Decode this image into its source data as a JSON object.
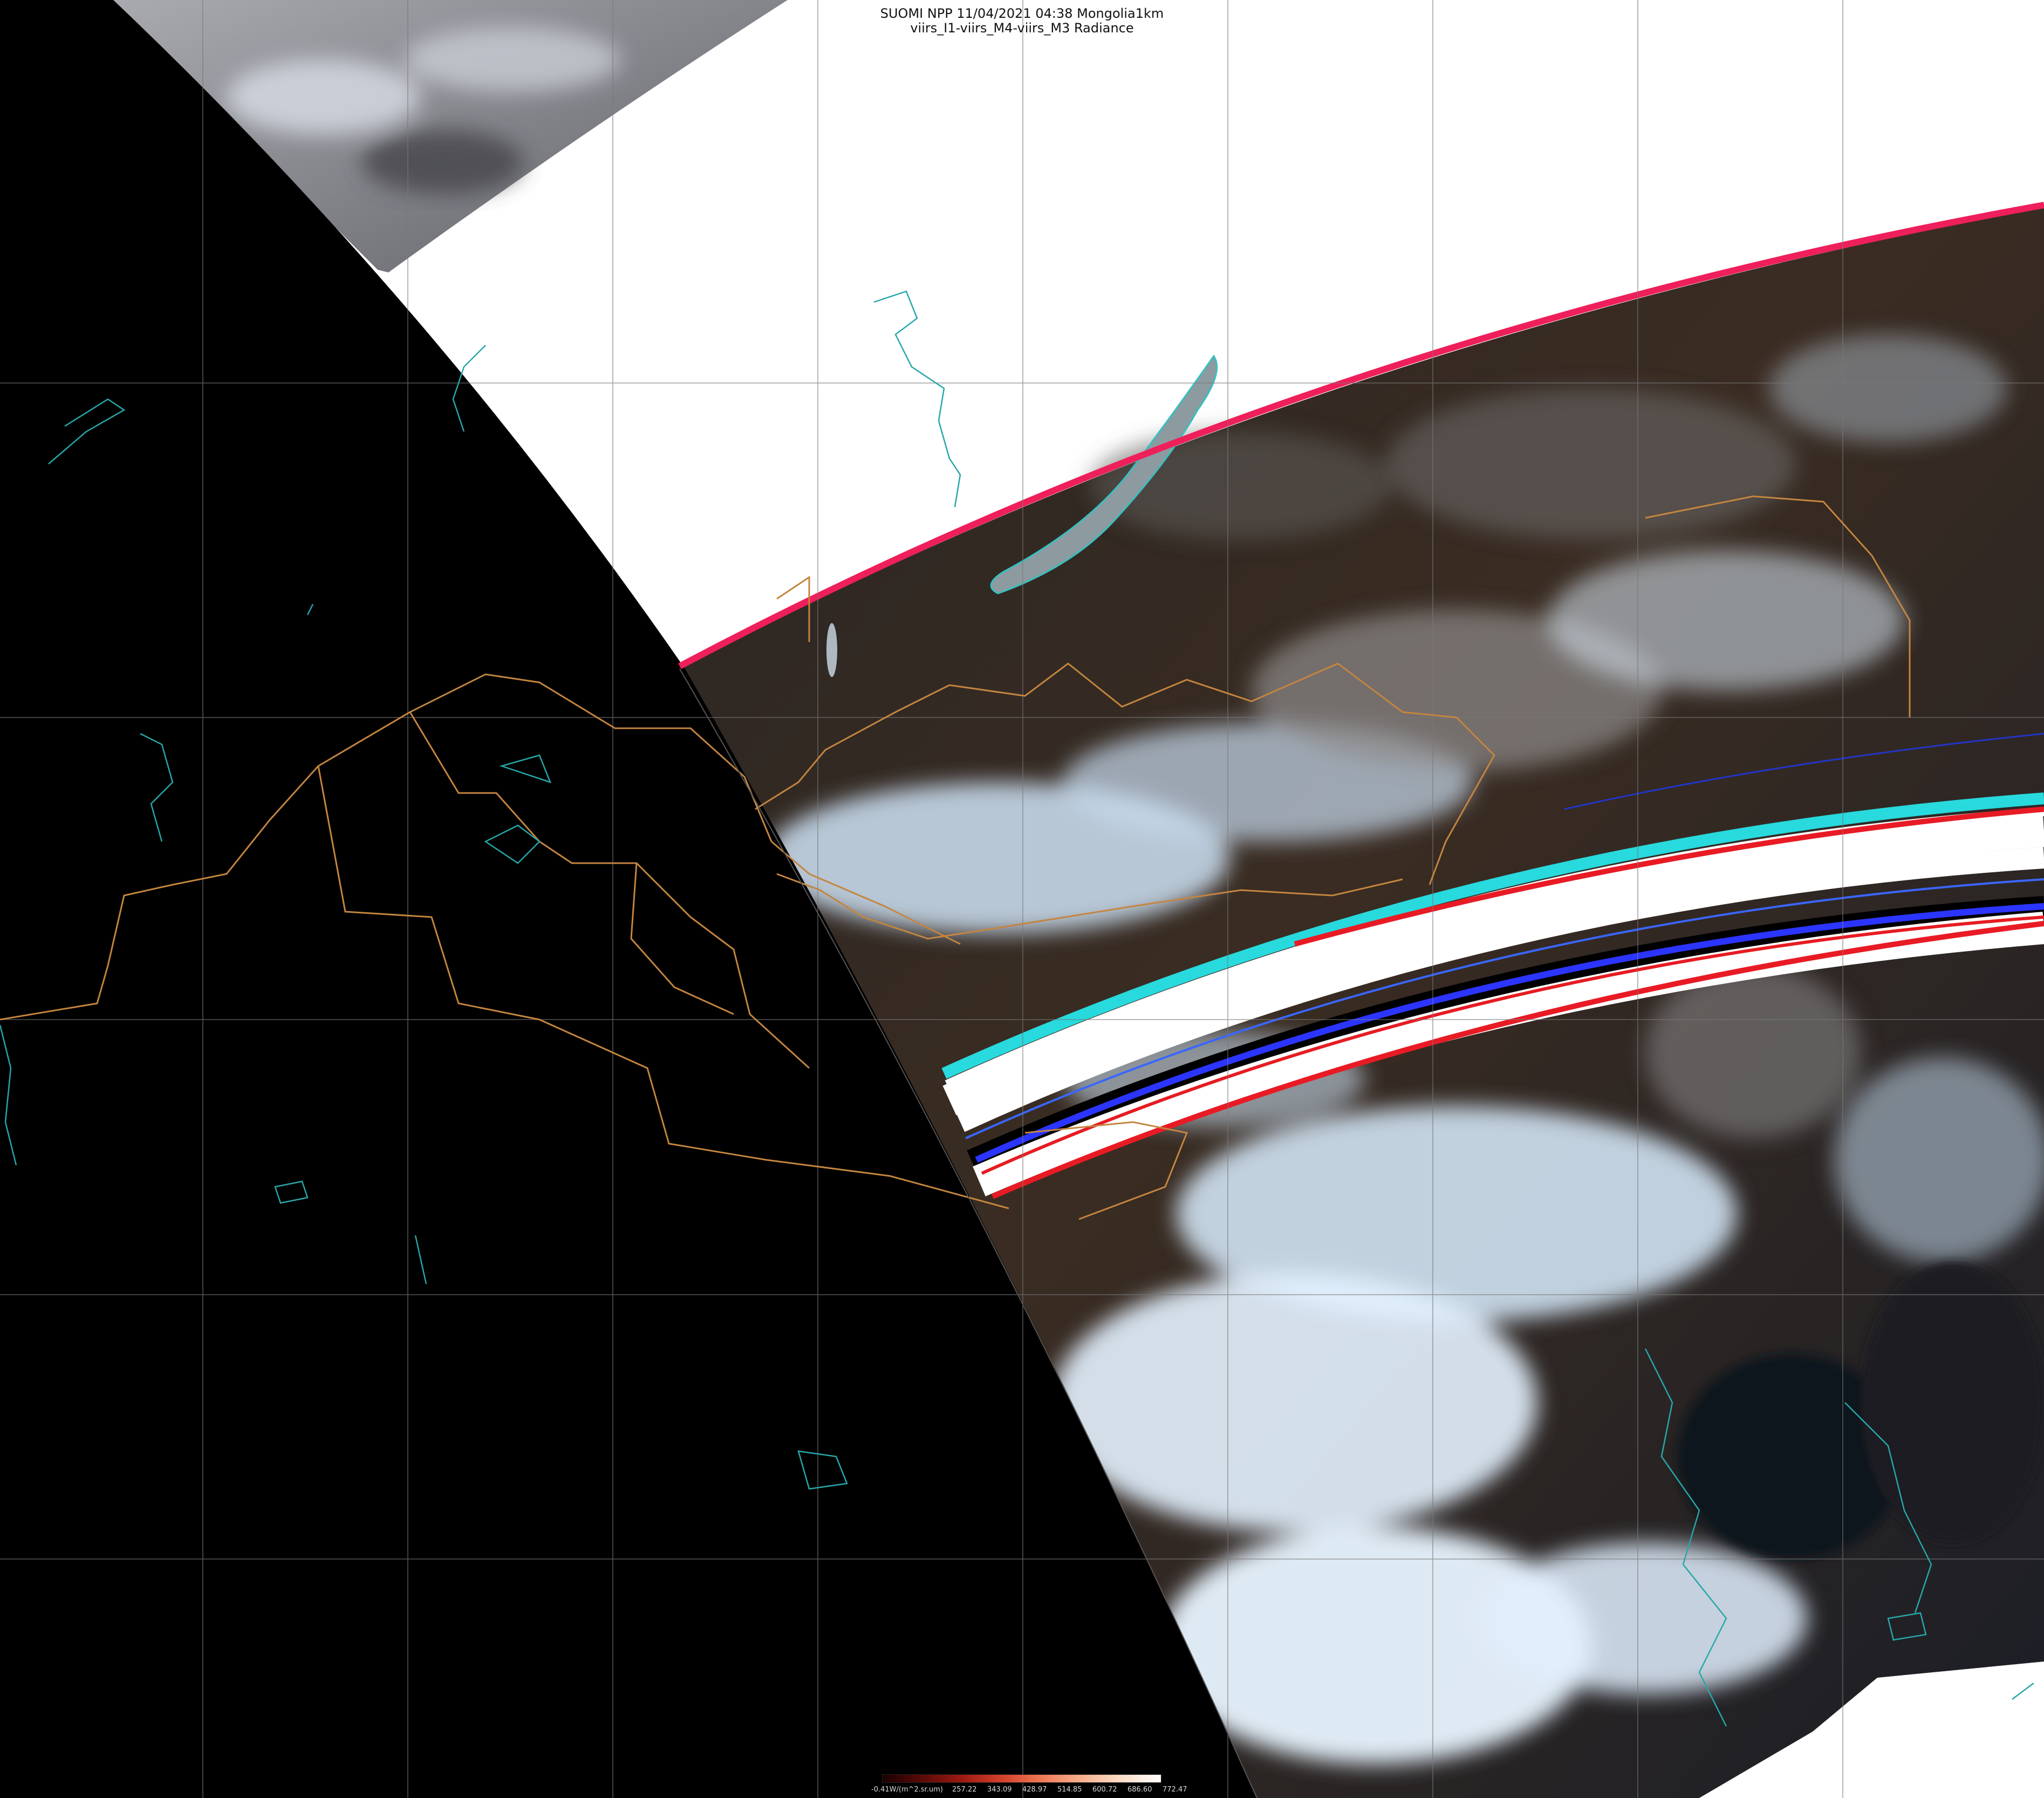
{
  "title": {
    "line1": "SUOMI NPP 11/04/2021 04:38 Mongolia1km",
    "line2": "viirs_I1-viirs_M4-viirs_M3 Radiance"
  },
  "colorbar": {
    "ticks": [
      "-0.41W/(m^2.sr.um)",
      "257.22",
      "343.09",
      "428.97",
      "514.85",
      "600.72",
      "686.60",
      "772.47"
    ],
    "colors": [
      "#1a0000",
      "#5a0a08",
      "#9b1a12",
      "#d2402a",
      "#ee7a55",
      "#f7b08e",
      "#fcdcc8",
      "#ffffff"
    ]
  },
  "map": {
    "projection_grid": "lat-lon graticule",
    "layers": [
      "satellite-swath",
      "country-borders",
      "coastlines-lakes",
      "graticule"
    ],
    "colors": {
      "no_data_night": "#000000",
      "no_data_background": "#ffffff",
      "border": "#c9894a",
      "coast": "#2aa6a6",
      "stripe_red": "#e8202c",
      "stripe_cyan": "#24d8dc",
      "stripe_blue": "#2a3dff",
      "cloud": "#d6ecff",
      "land": "#3a2a20"
    }
  }
}
